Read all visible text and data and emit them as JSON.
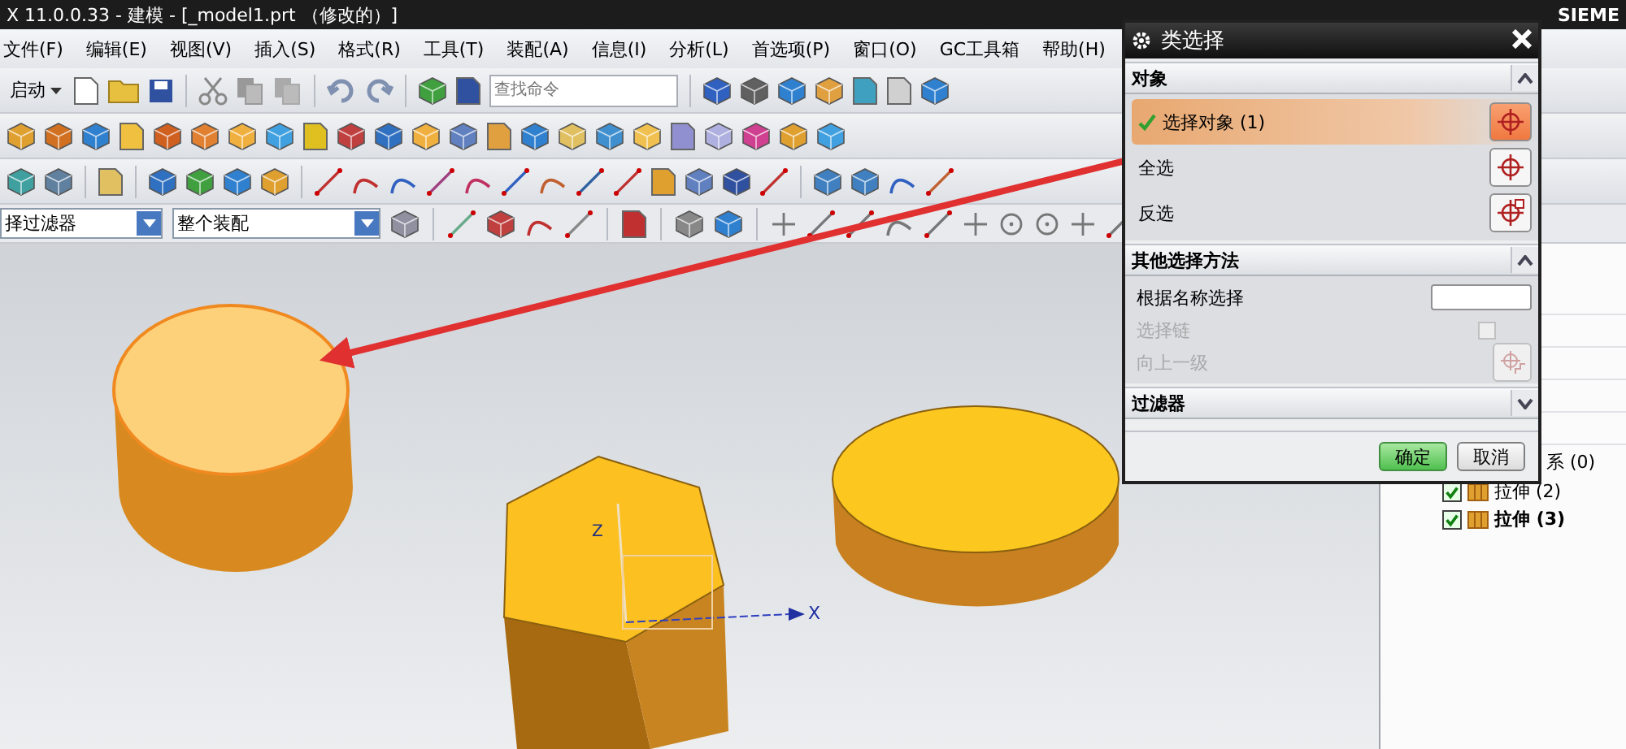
{
  "window": {
    "title": "X 11.0.0.33 - 建模 - [_model1.prt （修改的）]",
    "brand": "SIEME"
  },
  "menu": [
    "文件(F)",
    "编辑(E)",
    "视图(V)",
    "插入(S)",
    "格式(R)",
    "工具(T)",
    "装配(A)",
    "信息(I)",
    "分析(L)",
    "首选项(P)",
    "窗口(O)",
    "GC工具箱",
    "帮助(H)"
  ],
  "toolbar": {
    "start_label": "启动",
    "search_placeholder": "查找命令"
  },
  "filter_bar": {
    "type_filter": "择过滤器",
    "scope": "整个装配"
  },
  "axes": {
    "z": "Z",
    "x": "X"
  },
  "dialog": {
    "title": "类选择",
    "object_section": {
      "title": "对象",
      "expanded": true,
      "rows": [
        {
          "label": "选择对象 (1)",
          "selected": true
        },
        {
          "label": "全选",
          "selected": false
        },
        {
          "label": "反选",
          "selected": false
        }
      ]
    },
    "other_section": {
      "title": "其他选择方法",
      "expanded": true,
      "rows": [
        {
          "kind": "field",
          "label": "根据名称选择",
          "disabled": false
        },
        {
          "kind": "checkbox",
          "label": "选择链",
          "disabled": true,
          "checked": false
        },
        {
          "kind": "button",
          "label": "向上一级",
          "disabled": true
        }
      ]
    },
    "filter_section": {
      "title": "过滤器",
      "expanded": false
    },
    "buttons": [
      {
        "label": "确定",
        "primary": true
      },
      {
        "label": "取消",
        "primary": false
      }
    ]
  },
  "tree": [
    {
      "label": "系 (0)",
      "current": false
    },
    {
      "label": "拉伸 (2)",
      "checked": true,
      "current": false
    },
    {
      "label": "拉伸 (3)",
      "checked": true,
      "current": true
    }
  ]
}
